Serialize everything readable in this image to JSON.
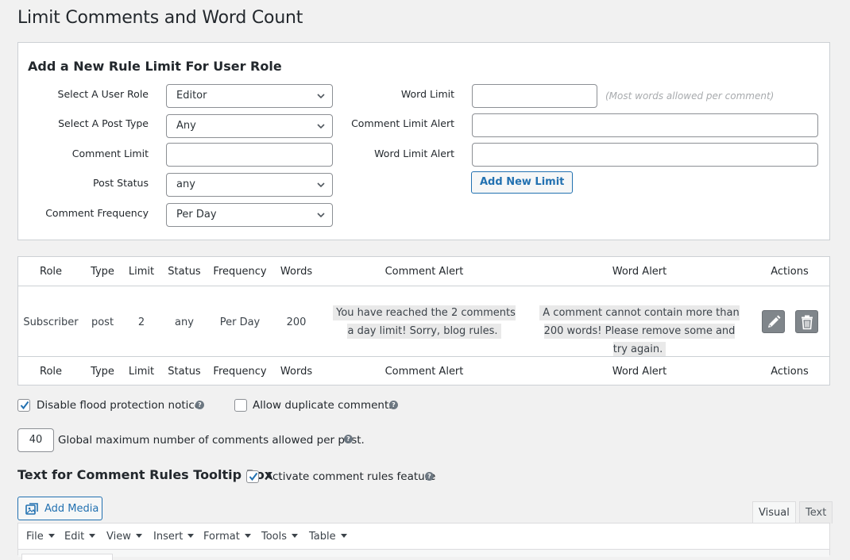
{
  "page_title": "Limit Comments and Word Count",
  "new_rule": {
    "heading": "Add a New Rule Limit For User Role",
    "labels": {
      "user_role": "Select A User Role",
      "post_type": "Select A Post Type",
      "comment_limit": "Comment Limit",
      "post_status": "Post Status",
      "comment_frequency": "Comment Frequency",
      "word_limit": "Word Limit",
      "comment_limit_alert": "Comment Limit Alert",
      "word_limit_alert": "Word Limit Alert"
    },
    "values": {
      "user_role": "Editor",
      "post_type": "Any",
      "comment_limit": "",
      "post_status": "any",
      "comment_frequency": "Per Day",
      "word_limit": "",
      "comment_limit_alert": "",
      "word_limit_alert": ""
    },
    "word_limit_hint": "(Most words allowed per comment)",
    "add_button": "Add New Limit"
  },
  "rules_table": {
    "columns": [
      "Role",
      "Type",
      "Limit",
      "Status",
      "Frequency",
      "Words",
      "Comment Alert",
      "Word Alert",
      "Actions"
    ],
    "rows": [
      {
        "role": "Subscriber",
        "type": "post",
        "limit": "2",
        "status": "any",
        "frequency": "Per Day",
        "words": "200",
        "comment_alert": "You have reached the 2 comments a day limit! Sorry, blog rules.",
        "word_alert": "A comment cannot contain more than 200 words! Please remove some and try again."
      }
    ]
  },
  "options": {
    "disable_flood_label": "Disable flood protection notice",
    "disable_flood_checked": true,
    "allow_duplicate_label": "Allow duplicate comments",
    "allow_duplicate_checked": false,
    "global_max_value": "40",
    "global_max_label": "Global maximum number of comments allowed per post."
  },
  "tooltip_section": {
    "heading": "Text for Comment Rules Tooltip Box",
    "activate_label": "Activate comment rules feature",
    "activate_checked": true
  },
  "editor": {
    "add_media": "Add Media",
    "tabs": [
      "Visual",
      "Text"
    ],
    "active_tab": "Visual",
    "menu": [
      "File",
      "Edit",
      "View",
      "Insert",
      "Format",
      "Tools",
      "Table"
    ]
  },
  "colors": {
    "accent": "#2271b1",
    "page_bg": "#f1f1f1",
    "icon_button_bg": "#80868b"
  }
}
